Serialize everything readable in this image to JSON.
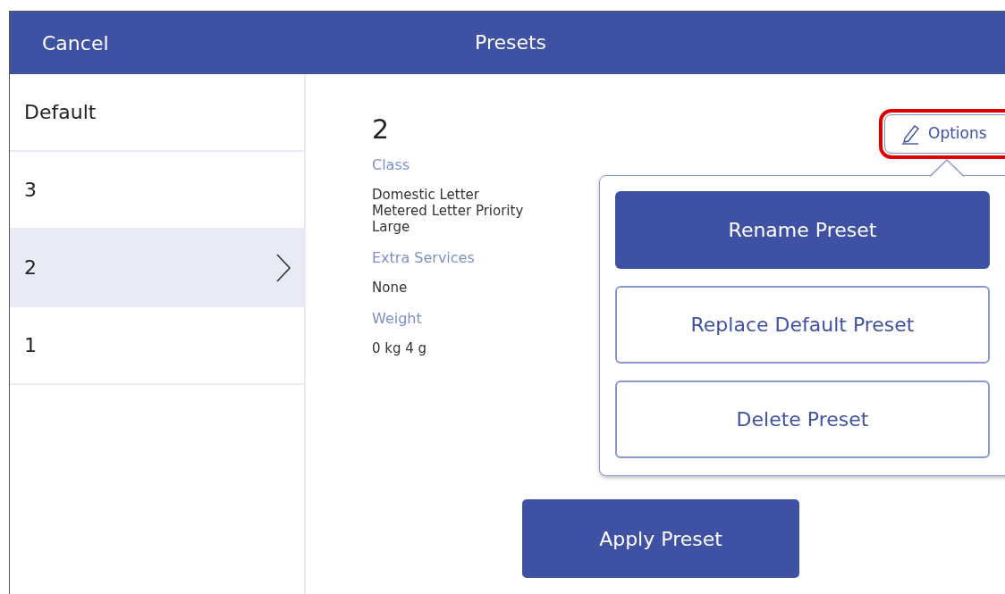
{
  "header": {
    "cancel": "Cancel",
    "title": "Presets"
  },
  "presets": [
    {
      "label": "Default",
      "selected": false
    },
    {
      "label": "3",
      "selected": false
    },
    {
      "label": "2",
      "selected": true
    },
    {
      "label": "1",
      "selected": false
    }
  ],
  "detail": {
    "name": "2",
    "options": {
      "label": "Options",
      "highlighted": true
    },
    "fields": [
      {
        "label": "Class",
        "value": "Domestic Letter\nMetered Letter Priority\nLarge"
      },
      {
        "label": "Extra Services",
        "value": "None"
      },
      {
        "label": "Weight",
        "value": "0 kg 4 g"
      }
    ],
    "apply": "Apply Preset"
  },
  "menu": {
    "open": true,
    "items": [
      {
        "label": "Rename Preset",
        "kind": "primary"
      },
      {
        "label": "Replace Default Preset",
        "kind": "outline"
      },
      {
        "label": "Delete Preset",
        "kind": "outline"
      }
    ]
  }
}
